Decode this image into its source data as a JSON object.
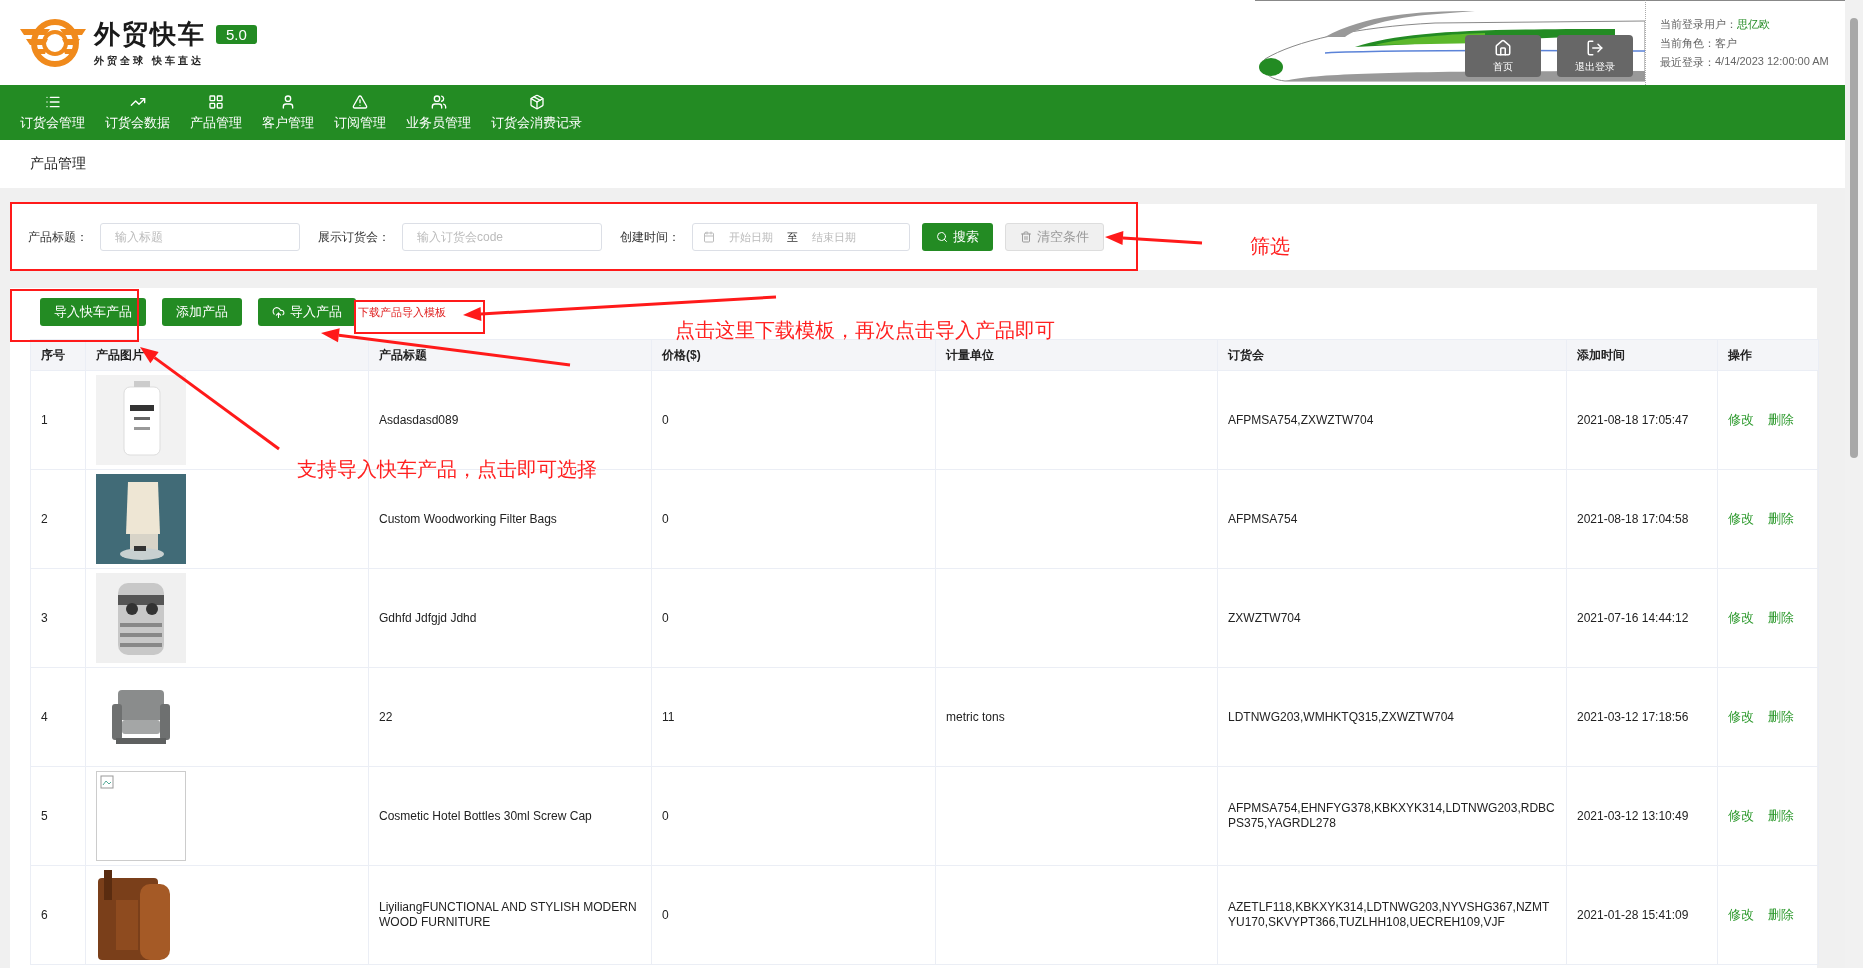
{
  "brand": {
    "name": "外贸快车",
    "slogan": "外贸全球 快车直达",
    "version": "5.0"
  },
  "header_buttons": [
    {
      "label": "首页",
      "kind": "home"
    },
    {
      "label": "退出登录",
      "kind": "logout"
    }
  ],
  "user_info": [
    {
      "label": "当前登录用户：",
      "value": "思亿欧",
      "kind": "highlight"
    },
    {
      "label": "当前角色：",
      "value": "客户",
      "kind": "plain"
    },
    {
      "label": "最近登录：",
      "value": "4/14/2023 12:00:00 AM",
      "kind": "plain"
    }
  ],
  "nav": [
    {
      "label": "订货会管理",
      "kind": "list"
    },
    {
      "label": "订货会数据",
      "kind": "chart"
    },
    {
      "label": "产品管理",
      "kind": "grid"
    },
    {
      "label": "客户管理",
      "kind": "user"
    },
    {
      "label": "订阅管理",
      "kind": "alert"
    },
    {
      "label": "业务员管理",
      "kind": "users"
    },
    {
      "label": "订货会消费记录",
      "kind": "box"
    }
  ],
  "breadcrumb": "产品管理",
  "filters": {
    "fields": [
      {
        "label": "产品标题：",
        "placeholder": "输入标题"
      },
      {
        "label": "展示订货会：",
        "placeholder": "输入订货会code"
      }
    ],
    "date": {
      "label": "创建时间：",
      "start_placeholder": "开始日期",
      "separator": "至",
      "end_placeholder": "结束日期"
    },
    "search_button": "搜索",
    "clear_button": "清空条件"
  },
  "actions": [
    {
      "label": "导入快车产品",
      "kind": "button"
    },
    {
      "label": "添加产品",
      "kind": "button"
    },
    {
      "label": "导入产品",
      "kind": "upload"
    },
    {
      "label": "下载产品导入模板",
      "kind": "link"
    }
  ],
  "table": {
    "columns": [
      "序号",
      "产品图片",
      "产品标题",
      "价格($)",
      "计量单位",
      "订货会",
      "添加时间",
      "操作"
    ],
    "rows": [
      {
        "index": "1",
        "kind": "picture",
        "title": "Asdasdasd089",
        "price": "0",
        "unit": "",
        "fairs": "AFPMSA754,ZXWZTW704",
        "added": "2021-08-18 17:05:47",
        "actions": [
          "修改",
          "删除"
        ]
      },
      {
        "index": "2",
        "kind": "picture",
        "title": "Custom Woodworking Filter Bags",
        "price": "0",
        "unit": "",
        "fairs": "AFPMSA754",
        "added": "2021-08-18 17:04:58",
        "actions": [
          "修改",
          "删除"
        ]
      },
      {
        "index": "3",
        "kind": "picture",
        "title": "Gdhfd Jdfgjd Jdhd",
        "price": "0",
        "unit": "",
        "fairs": "ZXWZTW704",
        "added": "2021-07-16 14:44:12",
        "actions": [
          "修改",
          "删除"
        ]
      },
      {
        "index": "4",
        "kind": "picture",
        "title": "22",
        "price": "11",
        "unit": "metric tons",
        "fairs": "LDTNWG203,WMHKTQ315,ZXWZTW704",
        "added": "2021-03-12 17:18:56",
        "actions": [
          "修改",
          "删除"
        ]
      },
      {
        "index": "5",
        "kind": "broken",
        "title": "Cosmetic Hotel Bottles 30ml Screw Cap",
        "price": "0",
        "unit": "",
        "fairs": "AFPMSA754,EHNFYG378,KBKXYK314,LDTNWG203,RDBCPS375,YAGRDL278",
        "added": "2021-03-12 13:10:49",
        "actions": [
          "修改",
          "删除"
        ]
      },
      {
        "index": "6",
        "kind": "picture",
        "title": "LiyiliangFUNCTIONAL AND STYLISH MODERN WOOD FURNITURE",
        "price": "0",
        "unit": "",
        "fairs": "AZETLF118,KBKXYK314,LDTNWG203,NYVSHG367,NZMTYU170,SKVYPT366,TUZLHH108,UECREH109,VJF",
        "added": "2021-01-28 15:41:09",
        "actions": [
          "修改",
          "删除"
        ]
      }
    ]
  },
  "annotations": [
    "筛选",
    "点击这里下载模板，再次点击导入产品即可",
    "支持导入快车产品，点击即可选择"
  ]
}
